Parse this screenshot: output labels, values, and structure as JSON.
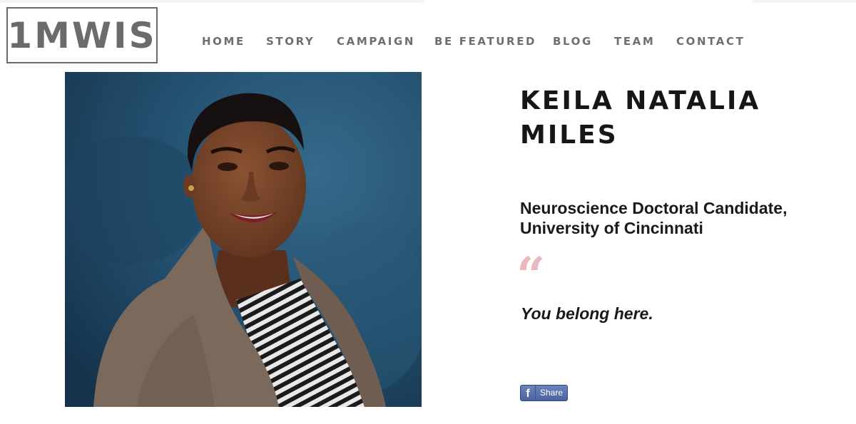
{
  "brand": {
    "logo_text": "1MWIS"
  },
  "nav": {
    "items": [
      "HOME",
      "STORY",
      "CAMPAIGN",
      "BE FEATURED",
      "BLOG",
      "TEAM",
      "CONTACT"
    ]
  },
  "profile": {
    "name": "KEILA NATALIA MILES",
    "role_line1": "Neuroscience Doctoral Candidate,",
    "role_line2": "University of Cincinnati",
    "quote_mark": "“",
    "quote": "You belong here."
  },
  "share": {
    "label": "Share",
    "icon": "facebook-icon",
    "icon_glyph": "f"
  },
  "colors": {
    "nav_text": "#6f6f6f",
    "logo": "#6b6b6b",
    "quote_mark": "#eab9bd",
    "share_button": "#5b74ad",
    "photo_background": "#224a66"
  }
}
